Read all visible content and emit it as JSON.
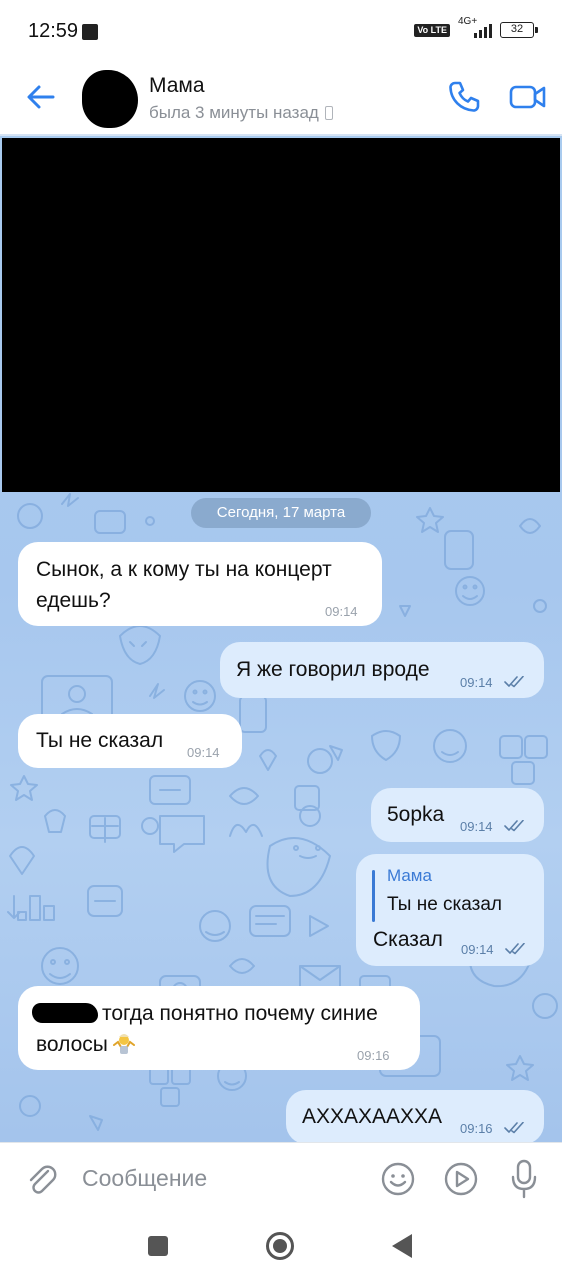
{
  "status_bar": {
    "time": "12:59",
    "network": "4G+",
    "battery": "32",
    "volte_label": "Vo LTE"
  },
  "header": {
    "contact_name": "Мама",
    "contact_status": "была 3 минуты назад",
    "accent_color": "#2f80ed"
  },
  "chat": {
    "date_separator": "Сегодня, 17 марта",
    "messages": [
      {
        "direction": "in",
        "text_line1": "Сынок, а к кому ты на концерт",
        "text_line2": "едешь?",
        "time": "09:14"
      },
      {
        "direction": "out",
        "text": "Я же говорил вроде",
        "time": "09:14",
        "read": true
      },
      {
        "direction": "in",
        "text": "Ты не сказал",
        "time": "09:14"
      },
      {
        "direction": "out",
        "text": "5opka",
        "time": "09:14",
        "read": true
      },
      {
        "direction": "out",
        "reply_to_name": "Мама",
        "reply_to_text": "Ты не сказал",
        "text": "Сказал",
        "time": "09:14",
        "read": true
      },
      {
        "direction": "in",
        "text_line1": "тогда понятно почему синие",
        "text_line2": "волосы",
        "emoji": "person-shrugging",
        "time": "09:16"
      },
      {
        "direction": "out",
        "text": "АХХАХААХХА",
        "time": "09:16",
        "read": true
      }
    ]
  },
  "composer": {
    "placeholder": "Сообщение"
  },
  "icons": {
    "back": "arrow-left-icon",
    "call": "phone-icon",
    "video": "video-camera-icon",
    "attach": "paperclip-icon",
    "sticker": "smiley-icon",
    "gif": "play-circle-icon",
    "mic": "microphone-icon"
  }
}
